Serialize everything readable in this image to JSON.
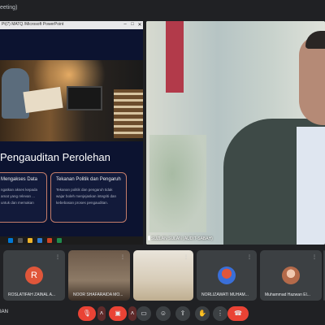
{
  "window": {
    "title": "eeting)"
  },
  "presentation": {
    "window_title": "Pt(7)  MATQ  /Microsoft PowerPoint",
    "window_buttons": [
      "–",
      "□",
      "✕"
    ],
    "slide": {
      "heading": "Pengauditan Perolehan",
      "card1": {
        "title": "Mengakses Data",
        "body": "ngatkan akses kepada amat yang relevan ... untuk dan memakan"
      },
      "card2": {
        "title": "Tekanan Politik dan Pengaruh",
        "body": "Tekanan politik dan pengaruh tidak wajar boleh menjejaskan integriti dan kebebasan proses pengauditan."
      }
    }
  },
  "speaker": {
    "name": "SUZLAN SULAN (AUDIT-SABAH)"
  },
  "participants": [
    {
      "name": "",
      "avatar_letter": ""
    },
    {
      "name": "ROSLATIFAH ZAINAL A...",
      "avatar_letter": "R",
      "avatar_color": "#e0563a"
    },
    {
      "name": "NOOR SHAFARAIDA MO...",
      "avatar_letter": ""
    },
    {
      "name": "",
      "avatar_letter": ""
    },
    {
      "name": "NORLIZAWATI MUHAM...",
      "avatar_letter": ""
    },
    {
      "name": "Muhammad Hazwan El...",
      "avatar_letter": ""
    },
    {
      "name": "",
      "avatar_letter": ""
    }
  ],
  "self": {
    "name": "IAN"
  },
  "controls": {
    "mic_icon": "mic-off-icon",
    "camera_icon": "camera-off-icon",
    "captions_icon": "captions-icon",
    "emoji_icon": "emoji-icon",
    "present_icon": "present-icon",
    "hand_icon": "raise-hand-icon",
    "more_icon": "more-icon",
    "end_icon": "end-call-icon",
    "accent_red": "#ea4335"
  }
}
